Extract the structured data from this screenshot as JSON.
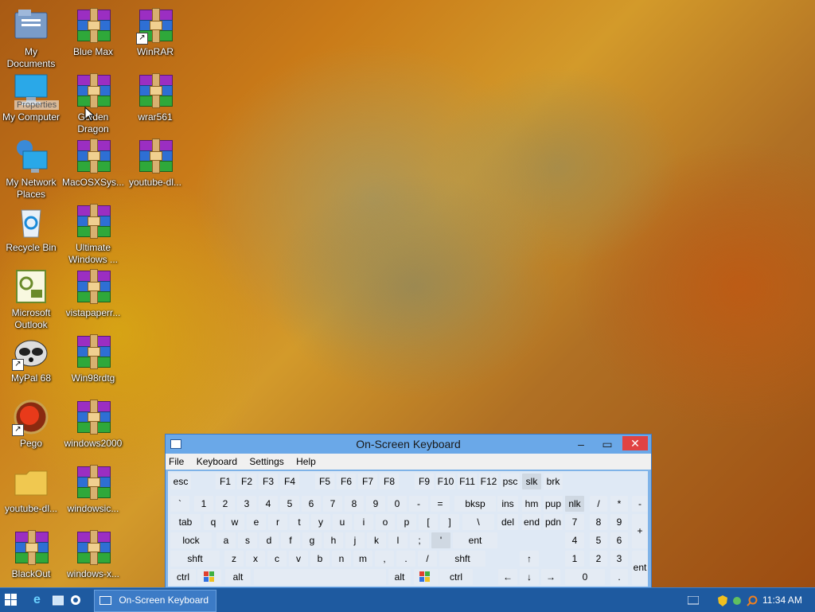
{
  "desktop_icons": [
    {
      "label": "My Documents",
      "icon": "folder-documents-icon"
    },
    {
      "label": "Blue Max",
      "icon": "winrar-archive-icon"
    },
    {
      "label": "WinRAR",
      "icon": "winrar-archive-icon"
    },
    {
      "label": "My Computer",
      "icon": "computer-icon"
    },
    {
      "label": "Golden Dragon",
      "icon": "winrar-archive-icon"
    },
    {
      "label": "wrar561",
      "icon": "winrar-archive-icon"
    },
    {
      "label": "My Network Places",
      "icon": "network-icon"
    },
    {
      "label": "MacOSXSys...",
      "icon": "winrar-archive-icon"
    },
    {
      "label": "youtube-dl...",
      "icon": "winrar-archive-icon"
    },
    {
      "label": "Recycle Bin",
      "icon": "recycle-bin-icon"
    },
    {
      "label": "Ultimate Windows ...",
      "icon": "winrar-archive-icon"
    },
    {
      "label": "Microsoft Outlook",
      "icon": "outlook-icon"
    },
    {
      "label": "vistapaperr...",
      "icon": "winrar-archive-icon"
    },
    {
      "label": "MyPal 68",
      "icon": "raccoon-icon"
    },
    {
      "label": "Win98rdtg",
      "icon": "winrar-archive-icon"
    },
    {
      "label": "Pego",
      "icon": "pego-icon"
    },
    {
      "label": "windows2000",
      "icon": "winrar-archive-icon"
    },
    {
      "label": "youtube-dl...",
      "icon": "folder-icon"
    },
    {
      "label": "windowsic...",
      "icon": "winrar-archive-icon"
    },
    {
      "label": "BlackOut",
      "icon": "winrar-archive-icon"
    },
    {
      "label": "windows-x...",
      "icon": "winrar-archive-icon"
    }
  ],
  "tooltip": "Properties",
  "osk": {
    "title": "On-Screen Keyboard",
    "menu": [
      "File",
      "Keyboard",
      "Settings",
      "Help"
    ],
    "row1": [
      "esc",
      "F1",
      "F2",
      "F3",
      "F4",
      "F5",
      "F6",
      "F7",
      "F8",
      "F9",
      "F10",
      "F11",
      "F12",
      "psc",
      "slk",
      "brk"
    ],
    "row2": [
      "`",
      "1",
      "2",
      "3",
      "4",
      "5",
      "6",
      "7",
      "8",
      "9",
      "0",
      "-",
      "=",
      "bksp",
      "ins",
      "hm",
      "pup",
      "nlk",
      "/",
      "*",
      "-"
    ],
    "row3": [
      "tab",
      "q",
      "w",
      "e",
      "r",
      "t",
      "y",
      "u",
      "i",
      "o",
      "p",
      "[",
      "]",
      "\\",
      "del",
      "end",
      "pdn",
      "7",
      "8",
      "9",
      "+"
    ],
    "row4": [
      "lock",
      "a",
      "s",
      "d",
      "f",
      "g",
      "h",
      "j",
      "k",
      "l",
      ";",
      "'",
      "ent",
      "4",
      "5",
      "6"
    ],
    "row5": [
      "shft",
      "z",
      "x",
      "c",
      "v",
      "b",
      "n",
      "m",
      ",",
      ".",
      "/",
      "shft",
      "1",
      "2",
      "3",
      "ent"
    ],
    "row6": [
      "ctrl",
      "alt",
      "alt",
      "ctrl",
      "0",
      "."
    ]
  },
  "taskbar": {
    "active_window": "On-Screen Keyboard",
    "clock": "11:34 AM"
  }
}
